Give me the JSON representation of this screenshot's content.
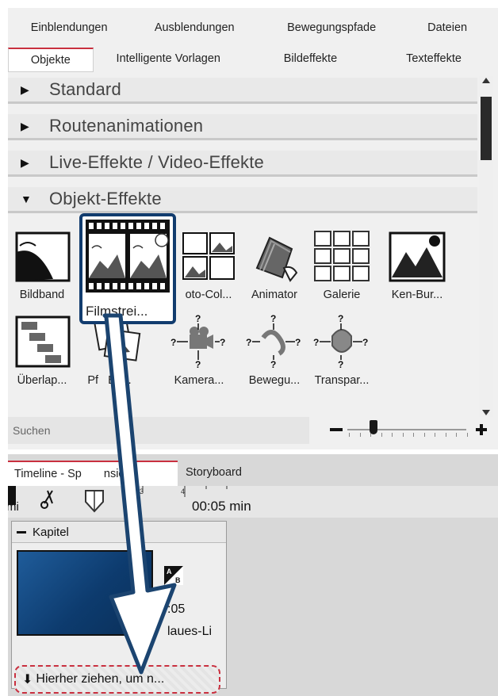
{
  "tabs_row1": [
    "Einblendungen",
    "Ausblendungen",
    "Bewegungspfade",
    "Dateien"
  ],
  "tabs_row2": [
    "Objekte",
    "Intelligente Vorlagen",
    "Bildeffekte",
    "Texteffekte"
  ],
  "active_tab_row2": "Objekte",
  "categories": [
    {
      "label": "Standard",
      "expanded": false
    },
    {
      "label": "Routenanimationen",
      "expanded": false
    },
    {
      "label": "Live-Effekte / Video-Effekte",
      "expanded": false
    },
    {
      "label": "Objekt-Effekte",
      "expanded": true
    }
  ],
  "effects_row1": [
    "Bildband",
    "Filmstrei...",
    "oto-Col...",
    "Animator",
    "Galerie",
    "Ken-Bur..."
  ],
  "effects_row2": [
    "Überlap...",
    "Pf",
    "Eff...",
    "Kamera...",
    "Bewegu...",
    "Transpar..."
  ],
  "search": {
    "placeholder": "Suchen"
  },
  "popup": {
    "label": "Filmstrei..."
  },
  "timeline": {
    "tabs": [
      "Timeline - Sp",
      "nsicht",
      "Storyboard"
    ],
    "ruler": {
      "mi": "mi",
      "t3": "3",
      "t4": "4",
      "time": "00:05 min"
    },
    "chapter": {
      "title": "Kapitel",
      "clip_time": ":05",
      "clip_name": "laues-Li",
      "dropzone": "Hierher ziehen, um n..."
    }
  },
  "colors": {
    "accent": "#c9303f",
    "popup_border": "#123c6e"
  }
}
